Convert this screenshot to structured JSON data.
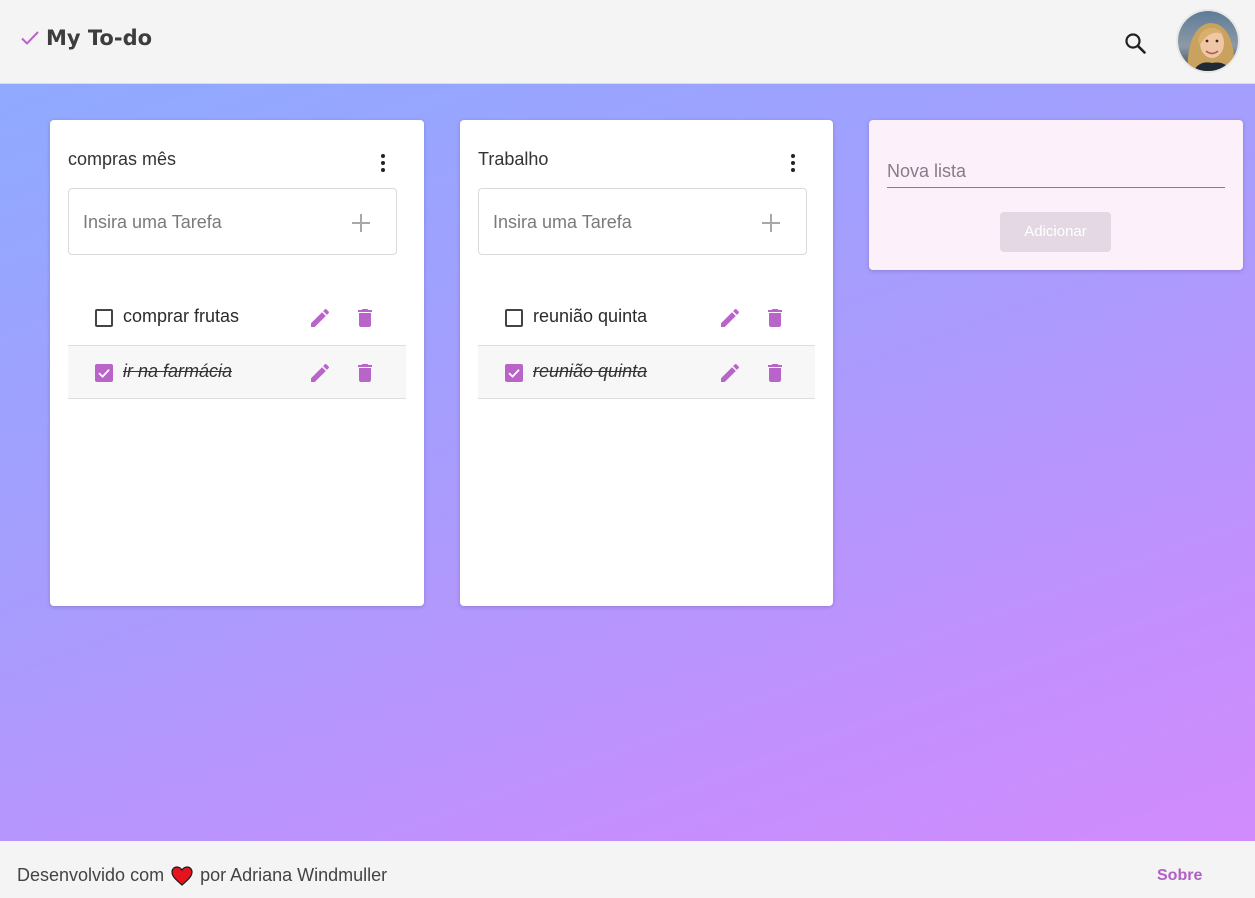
{
  "app": {
    "title": "My To-do",
    "brand_icon": "check-icon",
    "accent_color": "#b964c8"
  },
  "header": {
    "search_icon": "search-icon",
    "avatar_icon": "user-avatar"
  },
  "lists": [
    {
      "title": "compras mês",
      "input_placeholder": "Insira uma Tarefa",
      "tasks": [
        {
          "text": "comprar frutas",
          "done": false
        },
        {
          "text": "ir na farmácia",
          "done": true
        }
      ]
    },
    {
      "title": "Trabalho",
      "input_placeholder": "Insira uma Tarefa",
      "tasks": [
        {
          "text": "reunião quinta",
          "done": false
        },
        {
          "text": "reunião quinta",
          "done": true
        }
      ]
    }
  ],
  "new_list": {
    "placeholder": "Nova lista",
    "add_label": "Adicionar"
  },
  "footer": {
    "prefix": "Desenvolvido com",
    "suffix": "por Adriana Windmuller",
    "heart_icon": "heart-icon",
    "about_label": "Sobre"
  }
}
